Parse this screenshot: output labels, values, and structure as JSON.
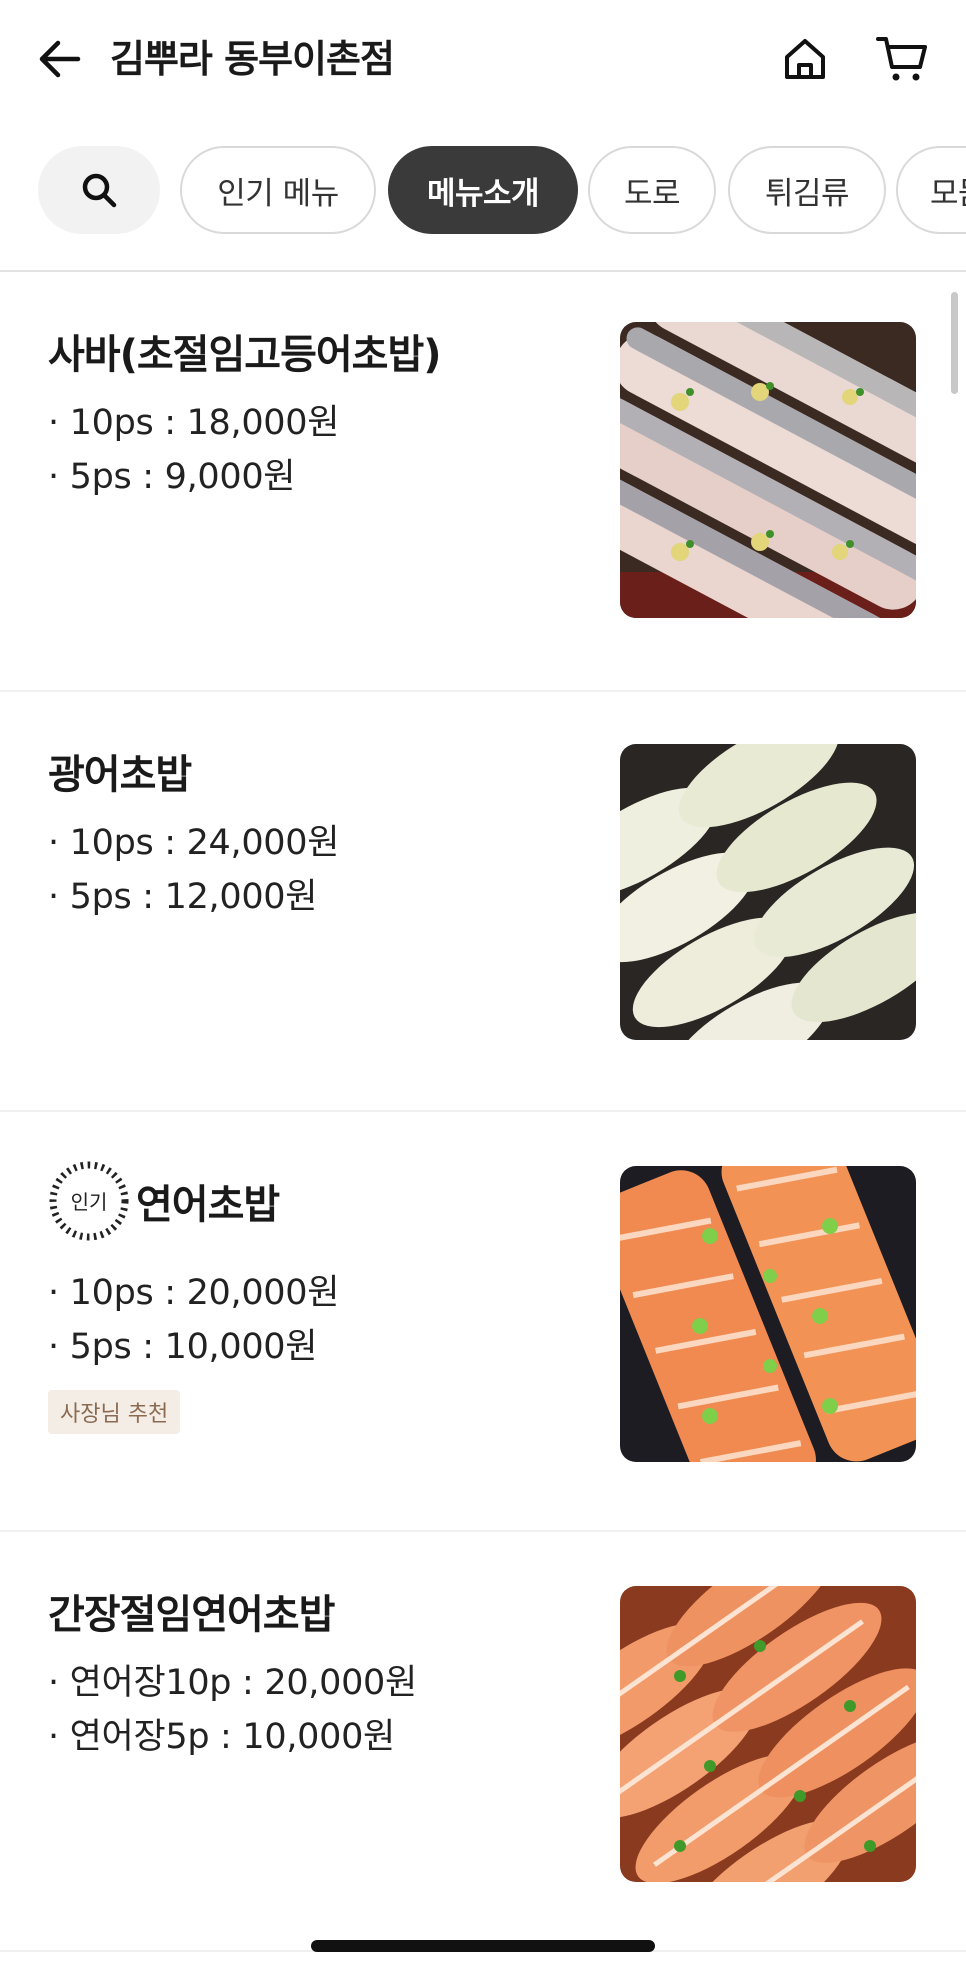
{
  "header": {
    "title": "김뿌라 동부이촌점",
    "back_icon": "arrow-left-icon",
    "home_icon": "home-icon",
    "cart_icon": "cart-icon"
  },
  "categories": {
    "search_icon": "search-icon",
    "chips": [
      "인기 메뉴",
      "메뉴소개",
      "도로",
      "튀김류",
      "모둠"
    ],
    "active": "메뉴소개"
  },
  "menu": [
    {
      "name": "사바(초절임고등어초밥)",
      "prices": [
        "· 10ps : 18,000원",
        "· 5ps : 9,000원"
      ],
      "popular": false,
      "tag": null,
      "image": "mackerel-sushi"
    },
    {
      "name": "광어초밥",
      "prices": [
        "· 10ps : 24,000원",
        "· 5ps : 12,000원"
      ],
      "popular": false,
      "tag": null,
      "image": "flounder-sushi"
    },
    {
      "name": "연어초밥",
      "prices": [
        "· 10ps : 20,000원",
        "· 5ps : 10,000원"
      ],
      "popular": true,
      "popular_label": "인기",
      "tag": "사장님 추천",
      "image": "salmon-sushi"
    },
    {
      "name": "간장절임연어초밥",
      "prices": [
        "· 연어장10p : 20,000원",
        "· 연어장5p : 10,000원"
      ],
      "popular": false,
      "tag": null,
      "image": "soy-marinated-salmon-sushi"
    }
  ],
  "colors": {
    "active_chip": "#3a3a3a",
    "tag_bg": "#f4ede6",
    "tag_text": "#8a6b52"
  }
}
